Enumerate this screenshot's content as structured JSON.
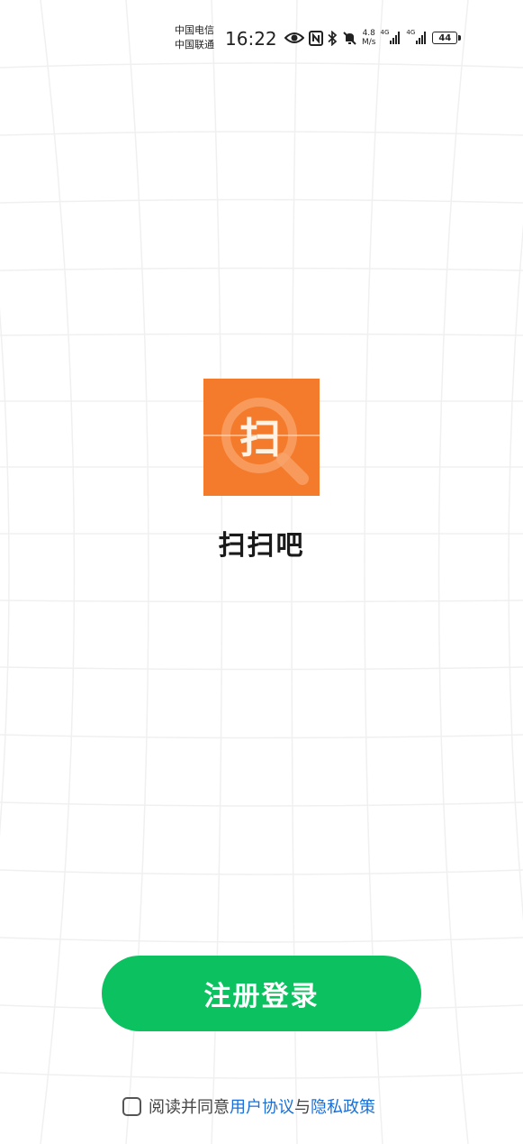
{
  "status_bar": {
    "carrier_1": "中国电信",
    "carrier_2": "中国联通",
    "time": "16:22",
    "net_speed_value": "4.8",
    "net_speed_unit": "M/s",
    "sim1_network": "4G",
    "sim2_network": "4G",
    "battery_level": "44",
    "icons": [
      "eye-icon",
      "nfc-icon",
      "bluetooth-icon",
      "mute-icon",
      "signal-icon",
      "signal-icon",
      "battery-icon"
    ]
  },
  "app": {
    "logo_char": "扫",
    "name": "扫扫吧"
  },
  "login": {
    "button_label": "注册登录"
  },
  "agreement": {
    "prefix": "阅读并同意",
    "user_agreement": "用户协议",
    "conjunction": "与",
    "privacy_policy": "隐私政策",
    "checked": false
  },
  "colors": {
    "button": "#0cc160",
    "logo_orange": "#f47a2c",
    "link": "#1a6fd6"
  }
}
